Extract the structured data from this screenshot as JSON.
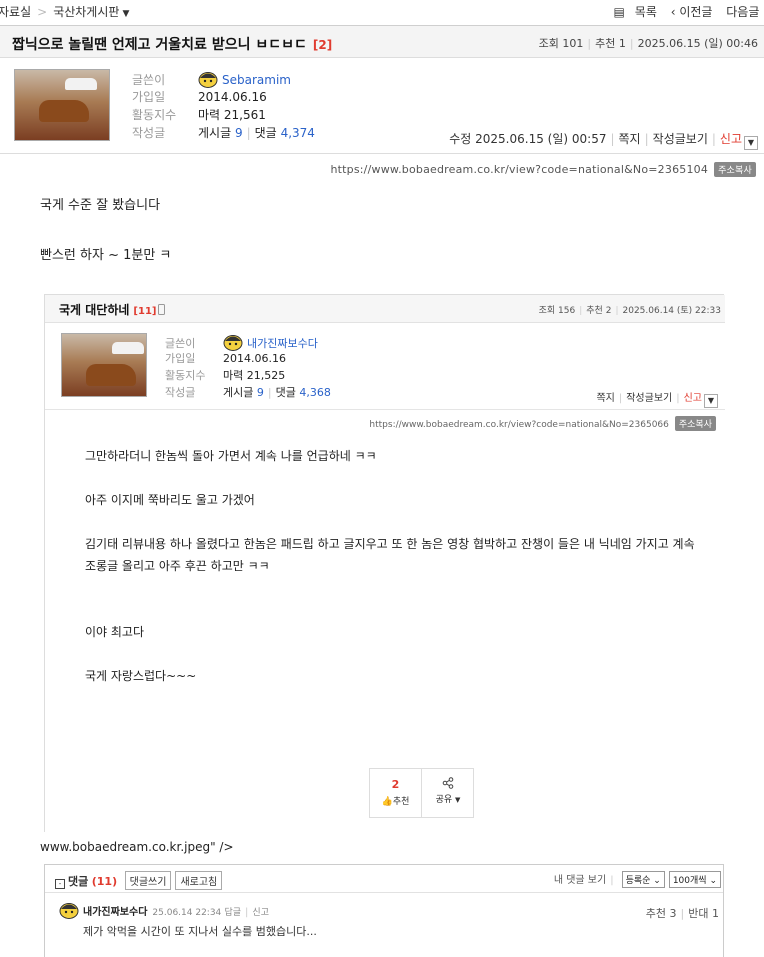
{
  "topnav": {
    "crumb1": "자료실",
    "crumb2": "국산차게시판",
    "list": "목록",
    "prev": "‹ 이전글",
    "next": "다음글 ›"
  },
  "post": {
    "title": "짭닉으로 놀릴땐 언제고 거울치료 받으니 ㅂㄷㅂㄷ",
    "comment_count": "[2]",
    "views_label": "조회",
    "views": "101",
    "rec_label": "추천",
    "rec": "1",
    "date": "2025.06.15 (일) 00:46",
    "author": {
      "writer_label": "글쓴이",
      "nick": "Sebaramim",
      "join_label": "가입일",
      "join": "2014.06.16",
      "activity_label": "활동지수",
      "power": "마력 21,561",
      "posts_label": "작성글",
      "posts_prefix": "게시글",
      "posts": "9",
      "comments_prefix": "댓글",
      "comments": "4,374"
    },
    "edited": "수정 2025.06.15 (일) 00:57",
    "message": "쪽지",
    "view_posts": "작성글보기",
    "report": "신고",
    "url": "https://www.bobaedream.co.kr/view?code=national&No=2365104",
    "copy_url": "주소복사",
    "body": [
      "국게 수준 잘 봤습니다",
      "빤스런 하자 ~ 1분만 ㅋ"
    ]
  },
  "embed": {
    "title": "국게 대단하네",
    "comment_count": "[11]",
    "views_label": "조회",
    "views": "156",
    "rec_label": "추천",
    "rec": "2",
    "date": "2025.06.14 (토) 22:33",
    "author": {
      "writer_label": "글쓴이",
      "nick": "내가진짜보수다",
      "join_label": "가입일",
      "join": "2014.06.16",
      "activity_label": "활동지수",
      "power": "마력 21,525",
      "posts_label": "작성글",
      "posts_prefix": "게시글",
      "posts": "9",
      "comments_prefix": "댓글",
      "comments": "4,368"
    },
    "message": "쪽지",
    "view_posts": "작성글보기",
    "report": "신고",
    "url": "https://www.bobaedream.co.kr/view?code=national&No=2365066",
    "copy_url": "주소복사",
    "body": [
      "그만하라더니 한놈씩 돌아 가면서 계속 나를 언급하네 ㅋㅋ",
      "",
      "아주 이지메 쭉바리도 울고 가겠어",
      "",
      "김기태 리뷰내용 하나 올렸다고 한놈은 패드립 하고 글지우고 또 한 놈은 영창 협박하고 잔챙이 들은 내 닉네임 가지고 계속",
      "조롱글 올리고 아주 후끈 하고만 ㅋㅋ",
      "",
      "",
      "이야 최고다",
      "",
      "국게 자랑스럽다~~~"
    ],
    "vote_count": "2",
    "vote_label": "추천",
    "share_label": "공유"
  },
  "tail_text": "www.bobaedream.co.kr.jpeg\" />",
  "comments": {
    "label": "댓글",
    "count": "(11)",
    "write": "댓글쓰기",
    "refresh": "새로고침",
    "my_comments": "내 댓글 보기",
    "sort": "등록순",
    "per_page": "100개씩",
    "item": {
      "nick": "내가진짜보수다",
      "date": "25.06.14 22:34",
      "reply": "답글",
      "report": "신고",
      "text": "제가 악먹을 시간이 또 지나서 실수를 범했습니다...",
      "rec": "추천 3",
      "opp": "반대 1"
    }
  }
}
